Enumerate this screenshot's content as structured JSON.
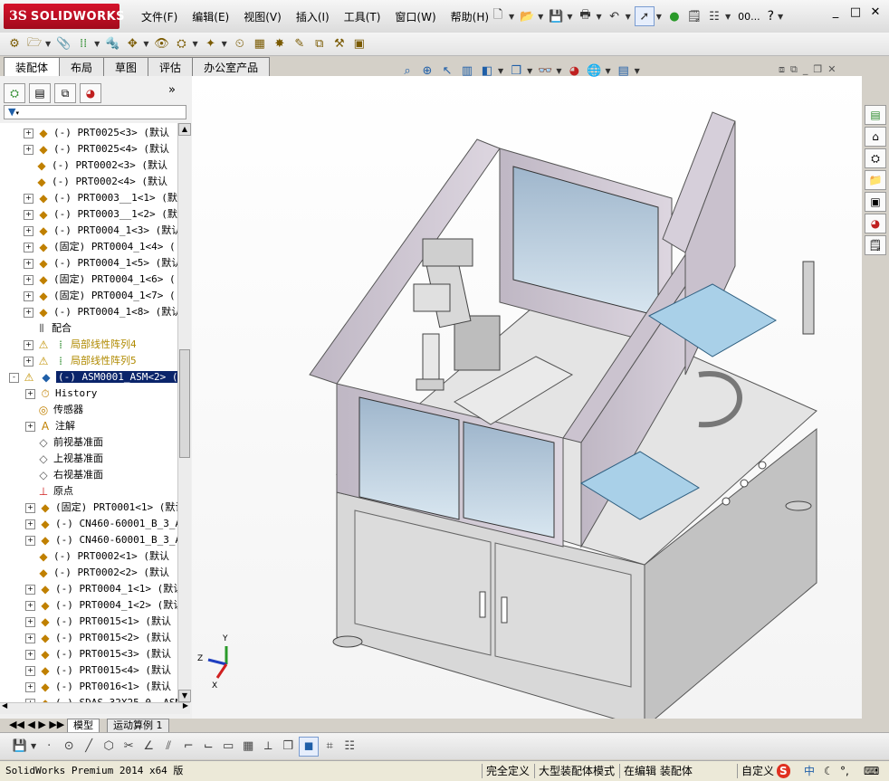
{
  "app": {
    "logo_ds": "3S",
    "logo_name": "SOLIDWORKS"
  },
  "menu": [
    "文件(F)",
    "编辑(E)",
    "视图(V)",
    "插入(I)",
    "工具(T)",
    "窗口(W)",
    "帮助(H)"
  ],
  "title_tools": {
    "ellipsis": "00...",
    "help": "?"
  },
  "window_controls": [
    "_",
    "□",
    "✕"
  ],
  "tabs": [
    "装配体",
    "布局",
    "草图",
    "评估",
    "办公室产品"
  ],
  "tree_items": [
    {
      "label": "(-) PRT0025<3> (默认",
      "type": "part",
      "expand": "+"
    },
    {
      "label": "(-) PRT0025<4> (默认",
      "type": "part",
      "expand": "+"
    },
    {
      "label": "(-) PRT0002<3> (默认",
      "type": "part",
      "expand": ""
    },
    {
      "label": "(-) PRT0002<4> (默认",
      "type": "part",
      "expand": ""
    },
    {
      "label": "(-) PRT0003__1<1> (默认",
      "type": "part",
      "expand": "+"
    },
    {
      "label": "(-) PRT0003__1<2> (默认",
      "type": "part",
      "expand": "+"
    },
    {
      "label": "(-) PRT0004_1<3> (默认",
      "type": "part",
      "expand": "+"
    },
    {
      "label": "(固定) PRT0004_1<4> (",
      "type": "part",
      "expand": "+"
    },
    {
      "label": "(-) PRT0004_1<5> (默认",
      "type": "part",
      "expand": "+"
    },
    {
      "label": "(固定) PRT0004_1<6> (",
      "type": "part",
      "expand": "+"
    },
    {
      "label": "(固定) PRT0004_1<7> (",
      "type": "part",
      "expand": "+"
    },
    {
      "label": "(-) PRT0004_1<8> (默认",
      "type": "part",
      "expand": "+"
    },
    {
      "label": "配合",
      "type": "mate",
      "expand": ""
    },
    {
      "label": "局部线性阵列4",
      "type": "pattern",
      "expand": "+"
    },
    {
      "label": "局部线性阵列5",
      "type": "pattern",
      "expand": "+"
    },
    {
      "label": "(-) ASM0001_ASM<2> (默认",
      "type": "assembly",
      "expand": "-",
      "selected": true
    },
    {
      "label": "History",
      "type": "history",
      "expand": "+"
    },
    {
      "label": "传感器",
      "type": "sensor",
      "expand": ""
    },
    {
      "label": "注解",
      "type": "annotation",
      "expand": "+"
    },
    {
      "label": "前视基准面",
      "type": "plane",
      "expand": ""
    },
    {
      "label": "上视基准面",
      "type": "plane",
      "expand": ""
    },
    {
      "label": "右视基准面",
      "type": "plane",
      "expand": ""
    },
    {
      "label": "原点",
      "type": "origin",
      "expand": ""
    },
    {
      "label": "(固定) PRT0001<1> (默认",
      "type": "part",
      "expand": "+"
    },
    {
      "label": "(-) CN460-60001_B_3_AS",
      "type": "part",
      "expand": "+"
    },
    {
      "label": "(-) CN460-60001_B_3_AS",
      "type": "part",
      "expand": "+"
    },
    {
      "label": "(-) PRT0002<1> (默认",
      "type": "part",
      "expand": ""
    },
    {
      "label": "(-) PRT0002<2> (默认",
      "type": "part",
      "expand": ""
    },
    {
      "label": "(-) PRT0004_1<1> (默认",
      "type": "part",
      "expand": "+"
    },
    {
      "label": "(-) PRT0004_1<2> (默认",
      "type": "part",
      "expand": "+"
    },
    {
      "label": "(-) PRT0015<1> (默认",
      "type": "part",
      "expand": "+"
    },
    {
      "label": "(-) PRT0015<2> (默认",
      "type": "part",
      "expand": "+"
    },
    {
      "label": "(-) PRT0015<3> (默认",
      "type": "part",
      "expand": "+"
    },
    {
      "label": "(-) PRT0015<4> (默认",
      "type": "part",
      "expand": "+"
    },
    {
      "label": "(-) PRT0016<1> (默认",
      "type": "part",
      "expand": "+"
    },
    {
      "label": "(-) SDAS-32X25_0__ASM",
      "type": "part",
      "expand": "+"
    }
  ],
  "bottom_tabs": [
    "模型",
    "运动算例 1"
  ],
  "status": {
    "product": "SolidWorks Premium 2014 x64 版",
    "definition": "完全定义",
    "mode": "大型装配体模式",
    "editing": "在编辑 装配体",
    "custom": "自定义",
    "ime": "中"
  },
  "triad": {
    "x": "X",
    "y": "Y",
    "z": "Z"
  },
  "colors": {
    "accent": "#d5122a",
    "selected": "#0a246a",
    "machine_frame": "#cfc7d2",
    "table_top": "#e2e2e2"
  }
}
